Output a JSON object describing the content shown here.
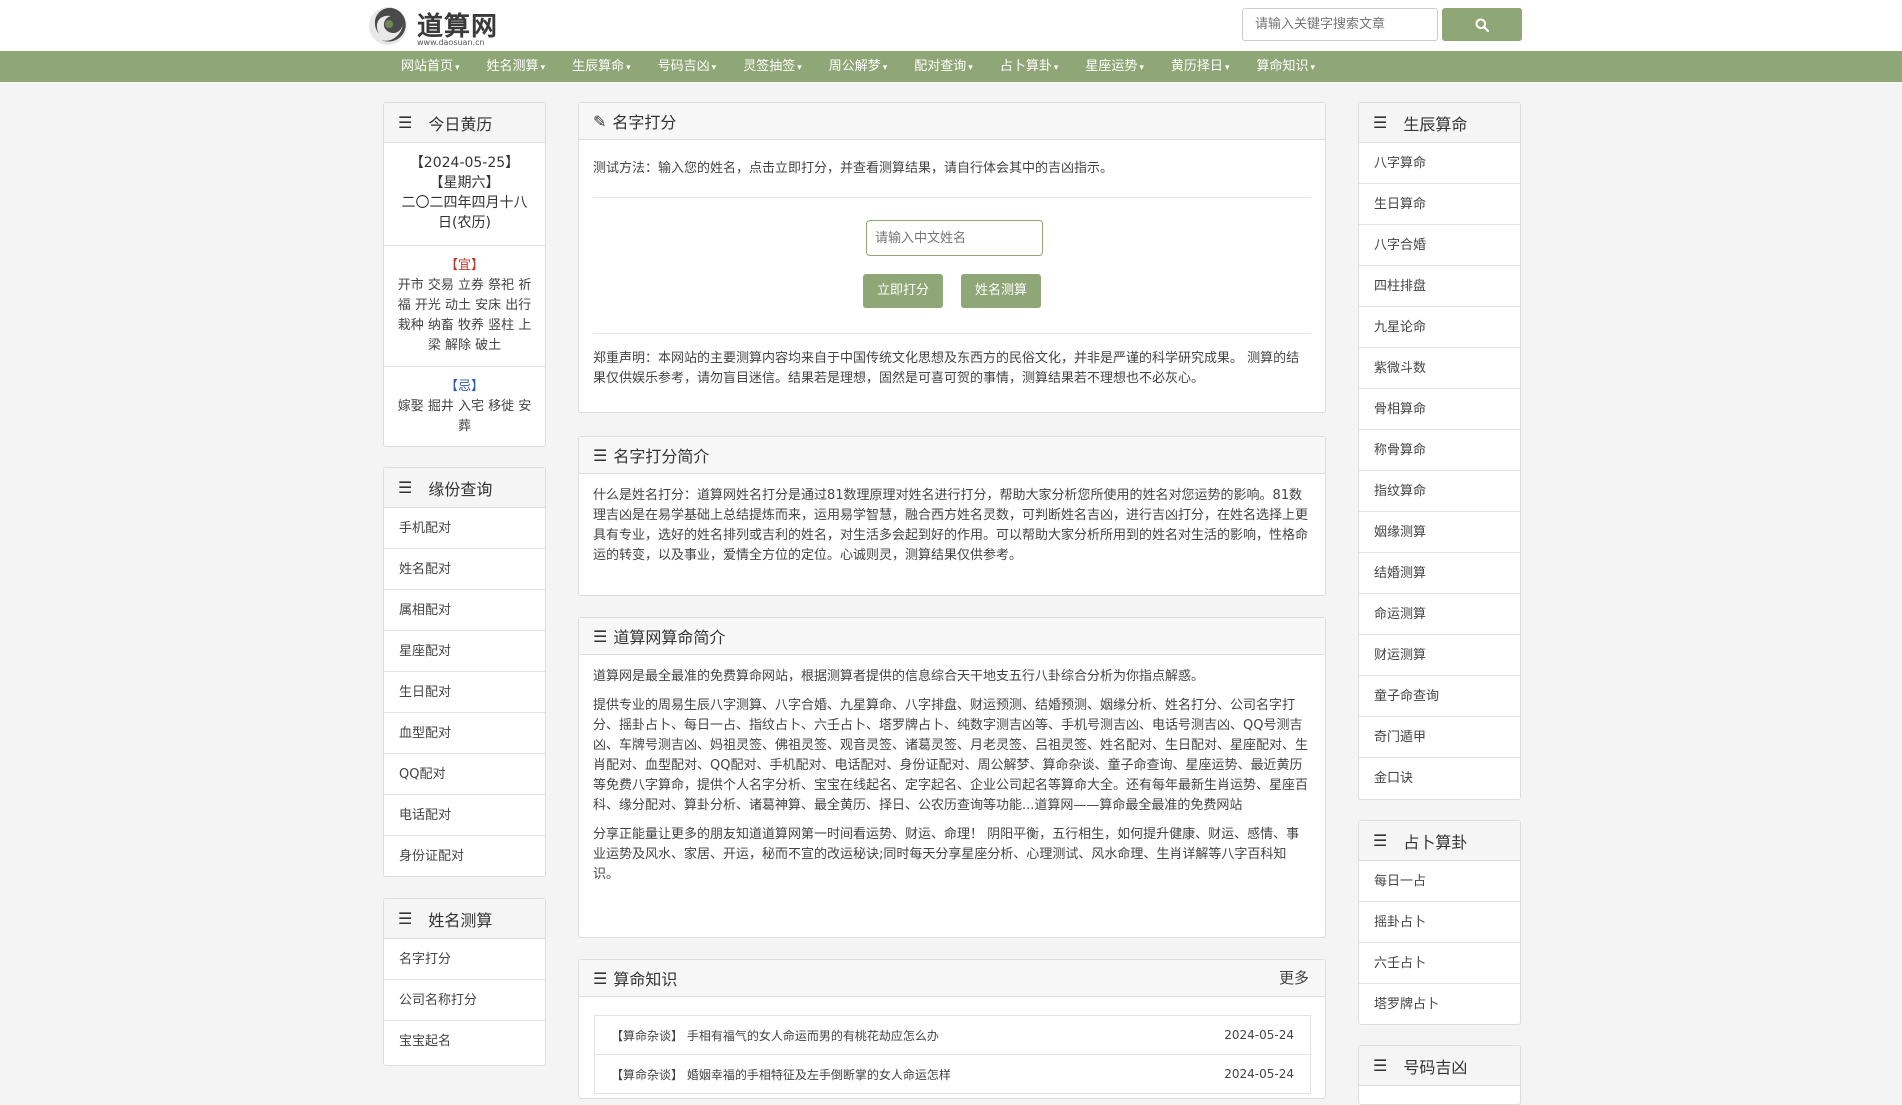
{
  "header": {
    "logo_text": "道算网",
    "logo_url": "www.daosuan.cn",
    "search_placeholder": "请输入关键字搜索文章"
  },
  "nav": {
    "items": [
      "网站首页",
      "姓名测算",
      "生辰算命",
      "号码吉凶",
      "灵签抽签",
      "周公解梦",
      "配对查询",
      "占卜算卦",
      "星座运势",
      "黄历择日",
      "算命知识"
    ]
  },
  "left": {
    "calendar": {
      "title": "今日黄历",
      "date": "【2024-05-25】",
      "weekday": "【星期六】",
      "lunar": "二〇二四年四月十八日(农历)",
      "yi_label": "【宜】",
      "yi_text": "开市 交易 立券 祭祀 祈福 开光 动土 安床 出行 栽种 纳畜 牧养 竖柱 上梁 解除 破土",
      "ji_label": "【忌】",
      "ji_text": "嫁娶 掘井 入宅 移徙 安葬"
    },
    "match": {
      "title": "缘份查询",
      "items": [
        "手机配对",
        "姓名配对",
        "属相配对",
        "星座配对",
        "生日配对",
        "血型配对",
        "QQ配对",
        "电话配对",
        "身份证配对"
      ]
    },
    "name": {
      "title": "姓名测算",
      "items": [
        "名字打分",
        "公司名称打分",
        "宝宝起名"
      ]
    }
  },
  "main": {
    "score": {
      "title": "名字打分",
      "method": "测试方法：输入您的姓名，点击立即打分，并查看测算结果，请自行体会其中的吉凶指示。",
      "input_placeholder": "请输入中文姓名",
      "btn_score": "立即打分",
      "btn_test": "姓名测算",
      "disclaimer": "郑重声明：本网站的主要测算内容均来自于中国传统文化思想及东西方的民俗文化，并非是严谨的科学研究成果。 测算的结果仅供娱乐参考，请勿盲目迷信。结果若是理想，固然是可喜可贺的事情，测算结果若不理想也不必灰心。"
    },
    "intro": {
      "title": "名字打分简介",
      "text": "什么是姓名打分：道算网姓名打分是通过81数理原理对姓名进行打分，帮助大家分析您所使用的姓名对您运势的影响。81数理吉凶是在易学基础上总结提炼而来，运用易学智慧，融合西方姓名灵数，可判断姓名吉凶，进行吉凶打分，在姓名选择上更具有专业，选好的姓名排列或吉利的姓名，对生活多会起到好的作用。可以帮助大家分析所用到的姓名对生活的影响，性格命运的转变，以及事业，爱情全方位的定位。心诚则灵，测算结果仅供参考。"
    },
    "about": {
      "title": "道算网算命简介",
      "p1": "道算网是最全最准的免费算命网站，根据测算者提供的信息综合天干地支五行八卦综合分析为你指点解惑。",
      "p2": "提供专业的周易生辰八字测算、八字合婚、九星算命、八字排盘、财运预测、结婚预测、姻缘分析、姓名打分、公司名字打分、摇卦占卜、每日一占、指纹占卜、六壬占卜、塔罗牌占卜、纯数字测吉凶等、手机号测吉凶、电话号测吉凶、QQ号测吉凶、车牌号测吉凶、妈祖灵签、佛祖灵签、观音灵签、诸葛灵签、月老灵签、吕祖灵签、姓名配对、生日配对、星座配对、生肖配对、血型配对、QQ配对、手机配对、电话配对、身份证配对、周公解梦、算命杂谈、童子命查询、星座运势、最近黄历等免费八字算命，提供个人名字分析、宝宝在线起名、定字起名、企业公司起名等算命大全。还有每年最新生肖运势、星座百科、缘分配对、算卦分析、诸葛神算、最全黄历、择日、公农历查询等功能...道算网——算命最全最准的免费网站",
      "p3": "分享正能量让更多的朋友知道道算网第一时间看运势、财运、命理！ 阴阳平衡，五行相生，如何提升健康、财运、感情、事业运势及风水、家居、开运，秘而不宣的改运秘诀;同时每天分享星座分析、心理测试、风水命理、生肖详解等八字百科知识。"
    },
    "knowledge": {
      "title": "算命知识",
      "more": "更多",
      "rows": [
        {
          "text": "【算命杂谈】 手相有福气的女人命运而男的有桃花劫应怎么办",
          "date": "2024-05-24"
        },
        {
          "text": "【算命杂谈】 婚姻幸福的手相特征及左手倒断掌的女人命运怎样",
          "date": "2024-05-24"
        }
      ]
    }
  },
  "right": {
    "birth": {
      "title": "生辰算命",
      "items": [
        "八字算命",
        "生日算命",
        "八字合婚",
        "四柱排盘",
        "九星论命",
        "紫微斗数",
        "骨相算命",
        "称骨算命",
        "指纹算命",
        "姻缘测算",
        "结婚测算",
        "命运测算",
        "财运测算",
        "童子命查询",
        "奇门遁甲",
        "金口诀"
      ]
    },
    "divination": {
      "title": "占卜算卦",
      "items": [
        "每日一占",
        "摇卦占卜",
        "六壬占卜",
        "塔罗牌占卜"
      ]
    },
    "number": {
      "title": "号码吉凶"
    }
  },
  "colors": {
    "accent": "#8fa676",
    "page_bg": "#f4f4f4",
    "yi": "#c0392b",
    "ji": "#2f5aa8"
  }
}
